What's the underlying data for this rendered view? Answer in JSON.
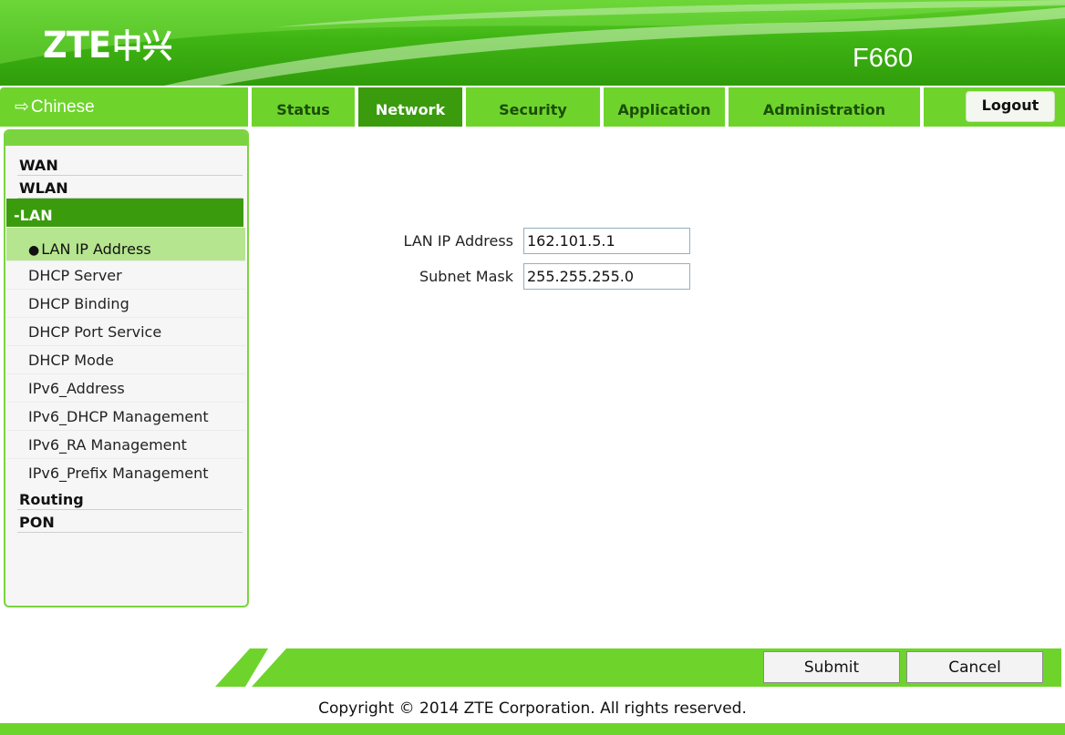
{
  "header": {
    "brand_latin": "ZTE",
    "brand_cn": "中兴",
    "model": "F660"
  },
  "nav": {
    "language_link": "Chinese",
    "tabs": [
      {
        "label": "Status"
      },
      {
        "label": "Network"
      },
      {
        "label": "Security"
      },
      {
        "label": "Application"
      },
      {
        "label": "Administration"
      }
    ],
    "active_tab": "Network",
    "logout_label": "Logout"
  },
  "sidebar": {
    "top_items": [
      "WAN",
      "WLAN"
    ],
    "section_label": "-LAN",
    "sub_items": [
      "LAN IP Address",
      "DHCP Server",
      "DHCP Binding",
      "DHCP Port Service",
      "DHCP Mode",
      "IPv6_Address",
      "IPv6_DHCP Management",
      "IPv6_RA Management",
      "IPv6_Prefix Management"
    ],
    "active_sub_item": "LAN IP Address",
    "bottom_items": [
      "Routing",
      "PON"
    ]
  },
  "form": {
    "lan_ip_label": "LAN IP Address",
    "lan_ip_value": "162.101.5.1",
    "subnet_label": "Subnet Mask",
    "subnet_value": "255.255.255.0"
  },
  "actions": {
    "submit_label": "Submit",
    "cancel_label": "Cancel"
  },
  "footer": {
    "copyright": "Copyright © 2014 ZTE Corporation. All rights reserved."
  },
  "colors": {
    "brand_green": "#3fb514",
    "tab_green": "#6ed42c",
    "active_green": "#3a9b0d",
    "active_sub_bg": "#b6e58f"
  }
}
